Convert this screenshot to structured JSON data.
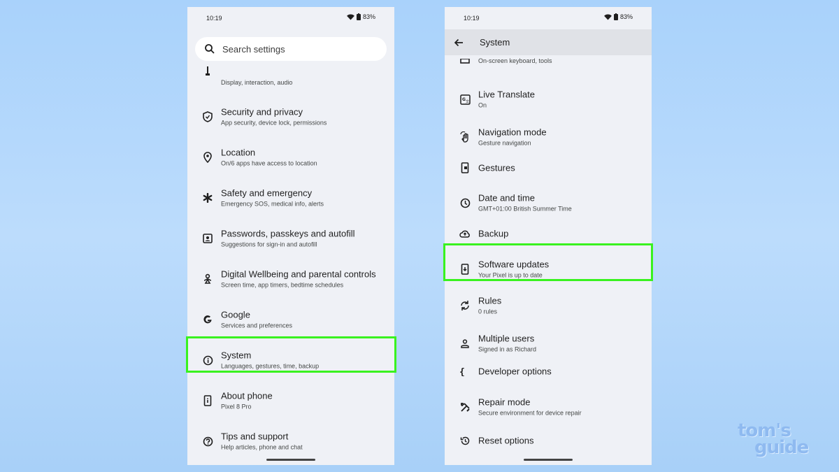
{
  "left": {
    "status": {
      "time": "10:19",
      "battery": "83%"
    },
    "search": {
      "placeholder": "Search settings"
    },
    "items": [
      {
        "title": "",
        "sub": "Display, interaction, audio",
        "icon": "accessibility-icon"
      },
      {
        "title": "Security and privacy",
        "sub": "App security, device lock, permissions",
        "icon": "shield-icon"
      },
      {
        "title": "Location",
        "sub": "On/6 apps have access to location",
        "icon": "location-pin-icon"
      },
      {
        "title": "Safety and emergency",
        "sub": "Emergency SOS, medical info, alerts",
        "icon": "asterisk-icon"
      },
      {
        "title": "Passwords, passkeys and autofill",
        "sub": "Suggestions for sign-in and autofill",
        "icon": "account-box-icon"
      },
      {
        "title": "Digital Wellbeing and parental controls",
        "sub": "Screen time, app timers, bedtime schedules",
        "icon": "wellbeing-icon"
      },
      {
        "title": "Google",
        "sub": "Services and preferences",
        "icon": "google-icon"
      },
      {
        "title": "System",
        "sub": "Languages, gestures, time, backup",
        "icon": "info-icon"
      },
      {
        "title": "About phone",
        "sub": "Pixel 8 Pro",
        "icon": "phone-info-icon"
      },
      {
        "title": "Tips and support",
        "sub": "Help articles, phone and chat",
        "icon": "help-icon"
      }
    ]
  },
  "right": {
    "status": {
      "time": "10:19",
      "battery": "83%"
    },
    "header": {
      "title": "System"
    },
    "items": [
      {
        "title": "",
        "sub": "On-screen keyboard, tools",
        "icon": "keyboard-icon"
      },
      {
        "title": "Live Translate",
        "sub": "On",
        "icon": "translate-icon"
      },
      {
        "title": "Navigation mode",
        "sub": "Gesture navigation",
        "icon": "gesture-hand-icon"
      },
      {
        "title": "Gestures",
        "sub": "",
        "icon": "phone-gesture-icon"
      },
      {
        "title": "Date and time",
        "sub": "GMT+01:00 British Summer Time",
        "icon": "clock-icon"
      },
      {
        "title": "Backup",
        "sub": "",
        "icon": "cloud-upload-icon"
      },
      {
        "title": "Software updates",
        "sub": "Your Pixel is up to date",
        "icon": "system-update-icon"
      },
      {
        "title": "Rules",
        "sub": "0 rules",
        "icon": "rules-icon"
      },
      {
        "title": "Multiple users",
        "sub": "Signed in as Richard",
        "icon": "person-icon"
      },
      {
        "title": "Developer options",
        "sub": "",
        "icon": "braces-icon"
      },
      {
        "title": "Repair mode",
        "sub": "Secure environment for device repair",
        "icon": "tools-icon"
      },
      {
        "title": "Reset options",
        "sub": "",
        "icon": "history-icon"
      }
    ]
  },
  "logo": {
    "line1": "tom's",
    "line2": "guide"
  }
}
